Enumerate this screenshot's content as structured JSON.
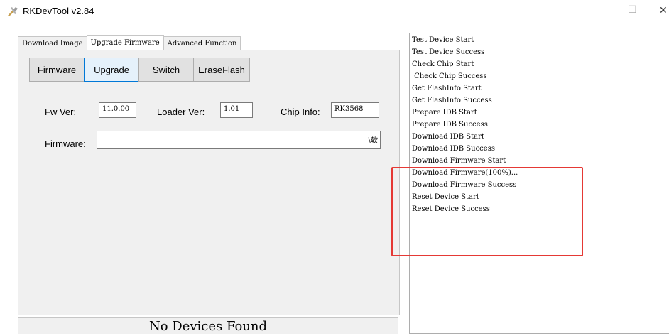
{
  "window": {
    "title": "RKDevTool v2.84",
    "minimize_glyph": "—",
    "maximize_glyph": "☐",
    "close_glyph": "✕"
  },
  "tabs": [
    {
      "label": "Download Image",
      "active": false
    },
    {
      "label": "Upgrade Firmware",
      "active": true
    },
    {
      "label": "Advanced Function",
      "active": false
    }
  ],
  "buttons": {
    "firmware": "Firmware",
    "upgrade": "Upgrade",
    "switch": "Switch",
    "erase_flash": "EraseFlash"
  },
  "info": {
    "fw_ver_label": "Fw Ver:",
    "fw_ver_value": "11.0.00",
    "loader_ver_label": "Loader Ver:",
    "loader_ver_value": "1.01",
    "chip_info_label": "Chip Info:",
    "chip_info_value": "RK3568",
    "firmware_label": "Firmware:",
    "firmware_path_tail": "\\软"
  },
  "status": "No Devices Found",
  "log": [
    "Test Device Start",
    "Test Device Success",
    "Check Chip Start",
    " Check Chip Success",
    "Get FlashInfo Start",
    "Get FlashInfo Success",
    "Prepare IDB Start",
    "Prepare IDB Success",
    "Download IDB Start",
    "Download IDB Success",
    "Download Firmware Start",
    "Download Firmware(100%)...",
    "Download Firmware Success",
    "Reset Device Start",
    "Reset Device Success"
  ],
  "colors": {
    "highlight": "#e53935",
    "panel_bg": "#f0f0f0",
    "selected_border": "#0078d7"
  }
}
